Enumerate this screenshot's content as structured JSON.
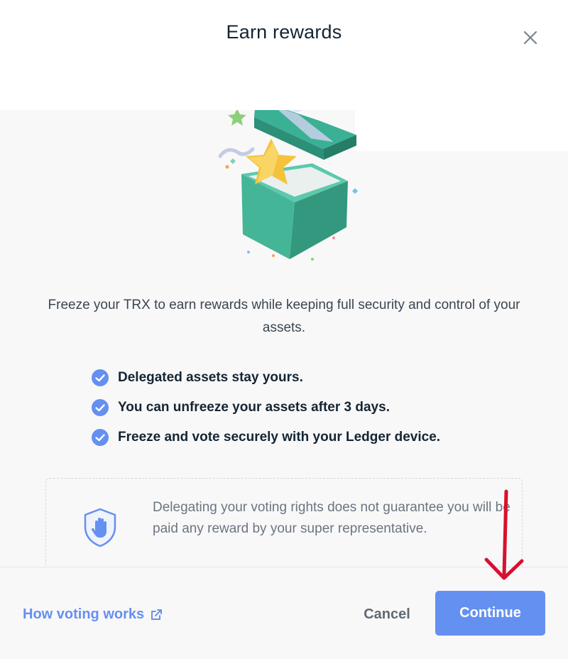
{
  "modal": {
    "title": "Earn rewards",
    "close_icon": "close-icon"
  },
  "illustration": {
    "name": "open-gift-box-with-star"
  },
  "intro": "Freeze your TRX to earn rewards while keeping full security and control of your assets.",
  "checklist": [
    {
      "icon": "check-circle-icon",
      "text": "Delegated assets stay yours."
    },
    {
      "icon": "check-circle-icon",
      "text": "You can unfreeze your assets after 3 days."
    },
    {
      "icon": "check-circle-icon",
      "text": "Freeze and vote securely with your Ledger device."
    }
  ],
  "info_box": {
    "icon": "shield-hand-icon",
    "text": "Delegating your voting rights does not guarantee you will be paid any reward by your super representative."
  },
  "footer": {
    "link_label": "How voting works",
    "link_icon": "external-link-icon",
    "cancel_label": "Cancel",
    "continue_label": "Continue"
  },
  "colors": {
    "accent": "#6490f1",
    "check": "#6490f1",
    "annotation": "#d8102f",
    "text_primary": "#142533"
  }
}
